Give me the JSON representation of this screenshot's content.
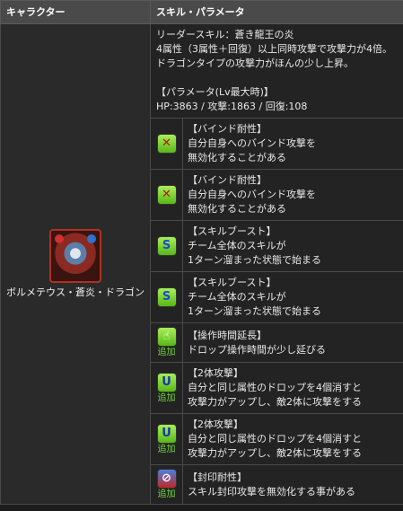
{
  "header": {
    "col_character": "キャラクター",
    "col_skill": "スキル・パラメータ"
  },
  "character": {
    "name": "ボルメテウス・蒼炎・ドラゴン"
  },
  "leader": {
    "title": "リーダースキル：蒼き龍王の炎",
    "line1": "4属性（3属性＋回復）以上同時攻撃で攻撃力が4倍。",
    "line2": "ドラゴンタイプの攻撃力がほんの少し上昇。",
    "param_title": "【パラメータ(Lv最大時)】",
    "params": "HP:3863 / 攻撃:1863 / 回復:108"
  },
  "awakenings": [
    {
      "icon": "bind-resist-icon",
      "icon_glyph": "✕",
      "icon_class": "ic-bind",
      "plus": "",
      "title": "【バインド耐性】",
      "lines": [
        "自分自身へのバインド攻撃を",
        "無効化することがある"
      ]
    },
    {
      "icon": "bind-resist-icon",
      "icon_glyph": "✕",
      "icon_class": "ic-bind",
      "plus": "",
      "title": "【バインド耐性】",
      "lines": [
        "自分自身へのバインド攻撃を",
        "無効化することがある"
      ]
    },
    {
      "icon": "skill-boost-icon",
      "icon_glyph": "S",
      "icon_class": "ic-skill",
      "plus": "",
      "title": "【スキルブースト】",
      "lines": [
        "チーム全体のスキルが",
        "1ターン溜まった状態で始まる"
      ]
    },
    {
      "icon": "skill-boost-icon",
      "icon_glyph": "S",
      "icon_class": "ic-skill",
      "plus": "",
      "title": "【スキルブースト】",
      "lines": [
        "チーム全体のスキルが",
        "1ターン溜まった状態で始まる"
      ]
    },
    {
      "icon": "time-extend-icon",
      "icon_glyph": "☝",
      "icon_class": "ic-time",
      "plus": "追加",
      "title": "【操作時間延長】",
      "lines": [
        "ドロップ操作時間が少し延びる"
      ]
    },
    {
      "icon": "two-pronged-icon",
      "icon_glyph": "U",
      "icon_class": "ic-two",
      "plus": "追加",
      "title": "【2体攻撃】",
      "lines": [
        "自分と同じ属性のドロップを4個消すと",
        "攻撃力がアップし、敵2体に攻撃をする"
      ]
    },
    {
      "icon": "two-pronged-icon",
      "icon_glyph": "U",
      "icon_class": "ic-two",
      "plus": "追加",
      "title": "【2体攻撃】",
      "lines": [
        "自分と同じ属性のドロップを4個消すと",
        "攻撃力がアップし、敵2体に攻撃をする"
      ]
    },
    {
      "icon": "seal-resist-icon",
      "icon_glyph": "⊘",
      "icon_class": "ic-seal",
      "plus": "追加",
      "title": "【封印耐性】",
      "lines": [
        "スキル封印攻撃を無効化する事がある"
      ]
    }
  ]
}
